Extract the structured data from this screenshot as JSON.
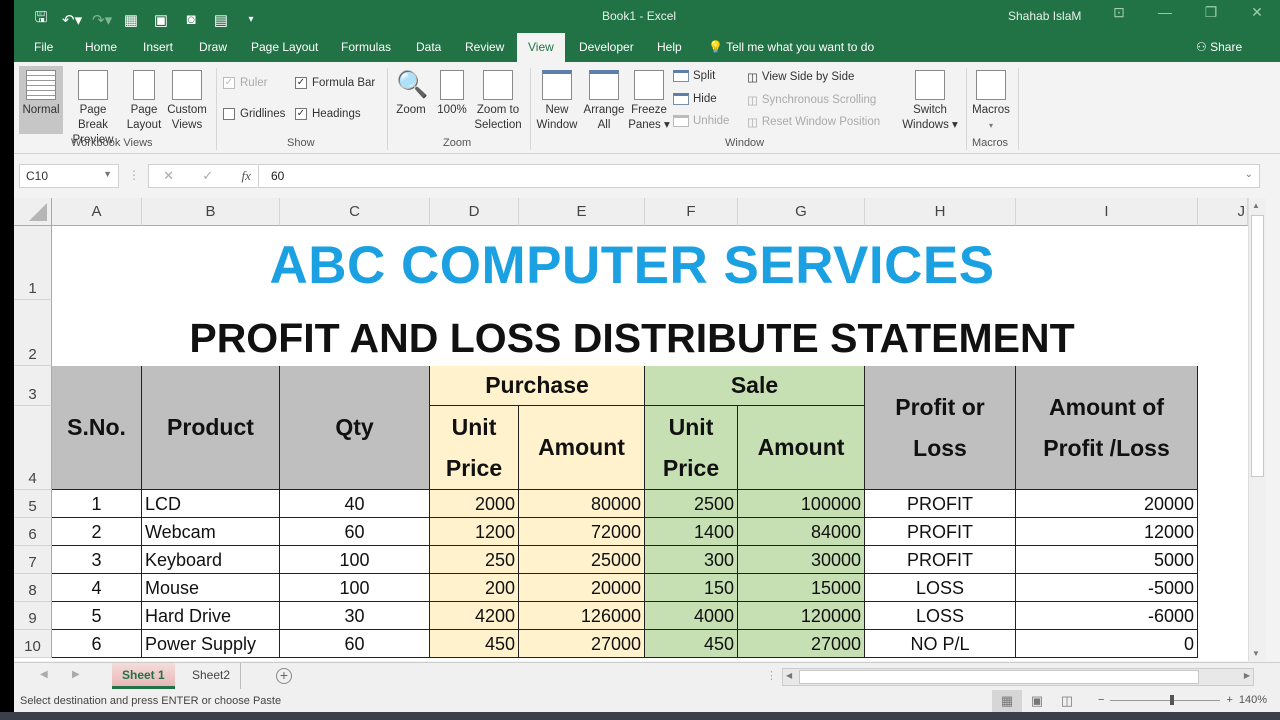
{
  "window": {
    "title": "Book1  -  Excel",
    "user": "Shahab IslaM",
    "controls": [
      "ribbon-display-icon",
      "minimize-icon",
      "restore-icon",
      "close-icon"
    ]
  },
  "quick_access": [
    "save-icon",
    "undo-icon",
    "redo-icon",
    "form-icon",
    "print-layout-icon",
    "camera-icon",
    "calculator-icon",
    "customize-icon"
  ],
  "tabs": [
    {
      "label": "File"
    },
    {
      "label": "Home"
    },
    {
      "label": "Insert"
    },
    {
      "label": "Draw"
    },
    {
      "label": "Page Layout"
    },
    {
      "label": "Formulas"
    },
    {
      "label": "Data"
    },
    {
      "label": "Review"
    },
    {
      "label": "View",
      "active": true
    },
    {
      "label": "Developer"
    },
    {
      "label": "Help"
    }
  ],
  "tell_me": "Tell me what you want to do",
  "share": "Share",
  "ribbon": {
    "workbook_views": {
      "label": "Workbook Views",
      "normal": "Normal",
      "page_break": [
        "Page Break",
        "Preview"
      ],
      "page_layout": [
        "Page",
        "Layout"
      ],
      "custom_views": [
        "Custom",
        "Views"
      ]
    },
    "show": {
      "label": "Show",
      "ruler": {
        "label": "Ruler",
        "checked": true,
        "disabled": true
      },
      "formula_bar": {
        "label": "Formula Bar",
        "checked": true
      },
      "gridlines": {
        "label": "Gridlines",
        "checked": false
      },
      "headings": {
        "label": "Headings",
        "checked": true
      }
    },
    "zoom": {
      "label": "Zoom",
      "zoom": "Zoom",
      "hundred": "100%",
      "to_selection": [
        "Zoom to",
        "Selection"
      ]
    },
    "window": {
      "label": "Window",
      "new_window": [
        "New",
        "Window"
      ],
      "arrange_all": [
        "Arrange",
        "All"
      ],
      "freeze_panes": [
        "Freeze",
        "Panes ▾"
      ],
      "split": "Split",
      "hide": "Hide",
      "unhide": "Unhide",
      "side_by_side": "View Side by Side",
      "sync_scroll": "Synchronous Scrolling",
      "reset_position": "Reset Window Position",
      "switch_windows": [
        "Switch",
        "Windows ▾"
      ]
    },
    "macros": {
      "label": "Macros",
      "macros": "Macros"
    }
  },
  "formula_bar": {
    "name_box": "C10",
    "value": "60"
  },
  "columns": [
    "A",
    "B",
    "C",
    "D",
    "E",
    "F",
    "G",
    "H",
    "I",
    "J"
  ],
  "rows": [
    "1",
    "2",
    "3",
    "4",
    "5",
    "6",
    "7",
    "8",
    "9",
    "10"
  ],
  "sheet": {
    "title": "ABC COMPUTER SERVICES",
    "subtitle": "PROFIT AND LOSS DISTRIBUTE STATEMENT",
    "headers": {
      "sno": "S.No.",
      "product": "Product",
      "qty": "Qty",
      "purchase": "Purchase",
      "sale": "Sale",
      "unit_price": "Unit Price",
      "amount": "Amount",
      "profit_or_loss": "Profit or Loss",
      "amount_pl": "Amount of Profit /Loss"
    },
    "data": [
      {
        "sno": "1",
        "product": "LCD",
        "qty": "40",
        "p_price": "2000",
        "p_amount": "80000",
        "s_price": "2500",
        "s_amount": "100000",
        "status": "PROFIT",
        "pl": "20000"
      },
      {
        "sno": "2",
        "product": "Webcam",
        "qty": "60",
        "p_price": "1200",
        "p_amount": "72000",
        "s_price": "1400",
        "s_amount": "84000",
        "status": "PROFIT",
        "pl": "12000"
      },
      {
        "sno": "3",
        "product": "Keyboard",
        "qty": "100",
        "p_price": "250",
        "p_amount": "25000",
        "s_price": "300",
        "s_amount": "30000",
        "status": "PROFIT",
        "pl": "5000"
      },
      {
        "sno": "4",
        "product": "Mouse",
        "qty": "100",
        "p_price": "200",
        "p_amount": "20000",
        "s_price": "150",
        "s_amount": "15000",
        "status": "LOSS",
        "pl": "-5000"
      },
      {
        "sno": "5",
        "product": "Hard Drive",
        "qty": "30",
        "p_price": "4200",
        "p_amount": "126000",
        "s_price": "4000",
        "s_amount": "120000",
        "status": "LOSS",
        "pl": "-6000"
      },
      {
        "sno": "6",
        "product": "Power Supply",
        "qty": "60",
        "p_price": "450",
        "p_amount": "27000",
        "s_price": "450",
        "s_amount": "27000",
        "status": "NO P/L",
        "pl": "0"
      }
    ]
  },
  "sheet_tabs": [
    {
      "label": "Sheet 1",
      "active": true
    },
    {
      "label": "Sheet2"
    }
  ],
  "status": {
    "message": "Select destination and press ENTER or choose Paste",
    "zoom": "140%",
    "zoom_fraction": 0.56
  },
  "colors": {
    "brand": "#217346",
    "title": "#1ba1e2",
    "purchase_fill": "#fff2cc",
    "sale_fill": "#c6e0b4",
    "header_fill": "#bfbfbf"
  }
}
